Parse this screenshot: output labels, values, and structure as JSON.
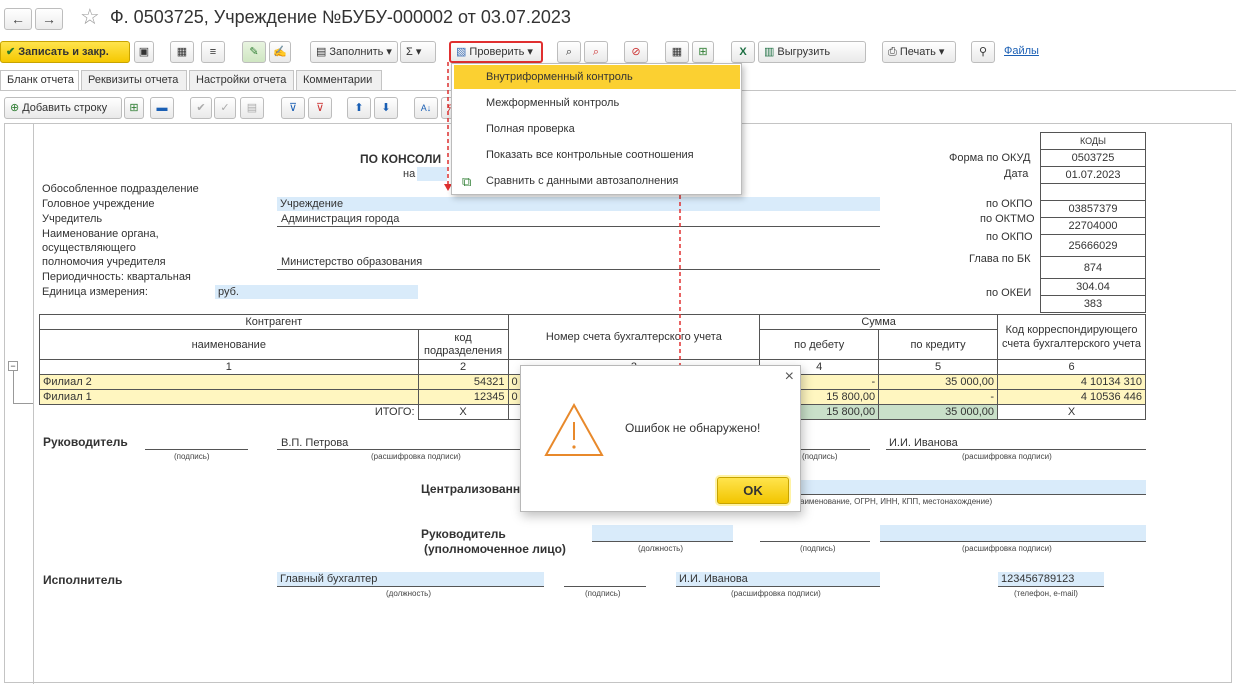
{
  "window": {
    "title": "Ф. 0503725, Учреждение №БУБУ-000002 от 03.07.2023"
  },
  "toolbar": {
    "save_close": "Записать и закр.",
    "fill": "Заполнить",
    "check": "Проверить",
    "export": "Выгрузить",
    "print": "Печать",
    "files": "Файлы"
  },
  "tabs": [
    "Бланк отчета",
    "Реквизиты отчета",
    "Настройки отчета",
    "Комментарии"
  ],
  "subtoolbar": {
    "add_row": "Добавить строку"
  },
  "check_menu": {
    "items": [
      "Внутриформенный контроль",
      "Межформенный контроль",
      "Полная проверка",
      "Показать все контрольные соотношения",
      "Сравнить с данными автозаполнения"
    ]
  },
  "form": {
    "heading": "ПО КОНСОЛИ",
    "heading_on": "на",
    "labels": {
      "separate": "Обособленное подразделение",
      "head": "Головное учреждение",
      "founder": "Учредитель",
      "authority1": "Наименование органа,",
      "authority2": "осуществляющего",
      "authority3": "полномочия учредителя",
      "periodicity": "Периодичность: квартальная",
      "unit": "Единица измерения:"
    },
    "values": {
      "head": "Учреждение",
      "founder": "Администрация города",
      "authority": "Министерство образования",
      "unit": "руб."
    },
    "codes": {
      "header": "КОДЫ",
      "rows": [
        {
          "label": "Форма по ОКУД",
          "value": "0503725"
        },
        {
          "label": "Дата",
          "value": "01.07.2023"
        },
        {
          "label": "",
          "value": ""
        },
        {
          "label": "по ОКПО",
          "value": "03857379"
        },
        {
          "label": "по ОКТМО",
          "value": "22704000"
        },
        {
          "label": "по ОКПО",
          "value": "25666029"
        },
        {
          "label": "Глава по БК",
          "value": "874"
        },
        {
          "label": "",
          "value": "304.04"
        },
        {
          "label": "по ОКЕИ",
          "value": "383"
        }
      ]
    }
  },
  "table": {
    "h_counterparty": "Контрагент",
    "h_name": "наименование",
    "h_code": "код подразделения",
    "h_account": "Номер счета бухгалтерского учета",
    "h_sum": "Сумма",
    "h_debit": "по дебету",
    "h_credit": "по кредиту",
    "h_corr": "Код корреспондирующего счета бухгалтерского учета",
    "nums": [
      "1",
      "2",
      "3",
      "4",
      "5",
      "6"
    ],
    "rows": [
      {
        "name": "Филиал 2",
        "code": "54321",
        "account": "0",
        "debit": "-",
        "credit": "35 000,00",
        "corr": "4 10134 310"
      },
      {
        "name": "Филиал 1",
        "code": "12345",
        "account": "0",
        "debit": "15 800,00",
        "credit": "-",
        "corr": "4 10536 446"
      }
    ],
    "total": {
      "label": "ИТОГО:",
      "code": "X",
      "debit": "15 800,00",
      "credit": "35 000,00",
      "corr": "X"
    }
  },
  "signatures": {
    "head": "Руководитель",
    "head_name": "В.П. Петрова",
    "chief_name": "И.И. Иванова",
    "sig_caption": "(подпись)",
    "decode_caption": "(расшифровка подписи)",
    "centralized": "Централизованн",
    "centralized_caption": "аименование, ОГРН, ИНН, КПП, местонахождение)",
    "head2a": "Руководитель",
    "head2b": "(уполномоченное лицо)",
    "position_caption": "(должность)",
    "executor": "Исполнитель",
    "executor_position": "Главный бухгалтер",
    "executor_name": "И.И. Иванова",
    "executor_phone": "123456789123",
    "phone_caption": "(телефон, e-mail)"
  },
  "dialog": {
    "message": "Ошибок не обнаружено!",
    "ok": "OK"
  },
  "colors": {
    "accent": "#fbd031",
    "error_frame": "#e03030",
    "field": "#d9ebfa",
    "row_highlight": "#fff6c0"
  }
}
